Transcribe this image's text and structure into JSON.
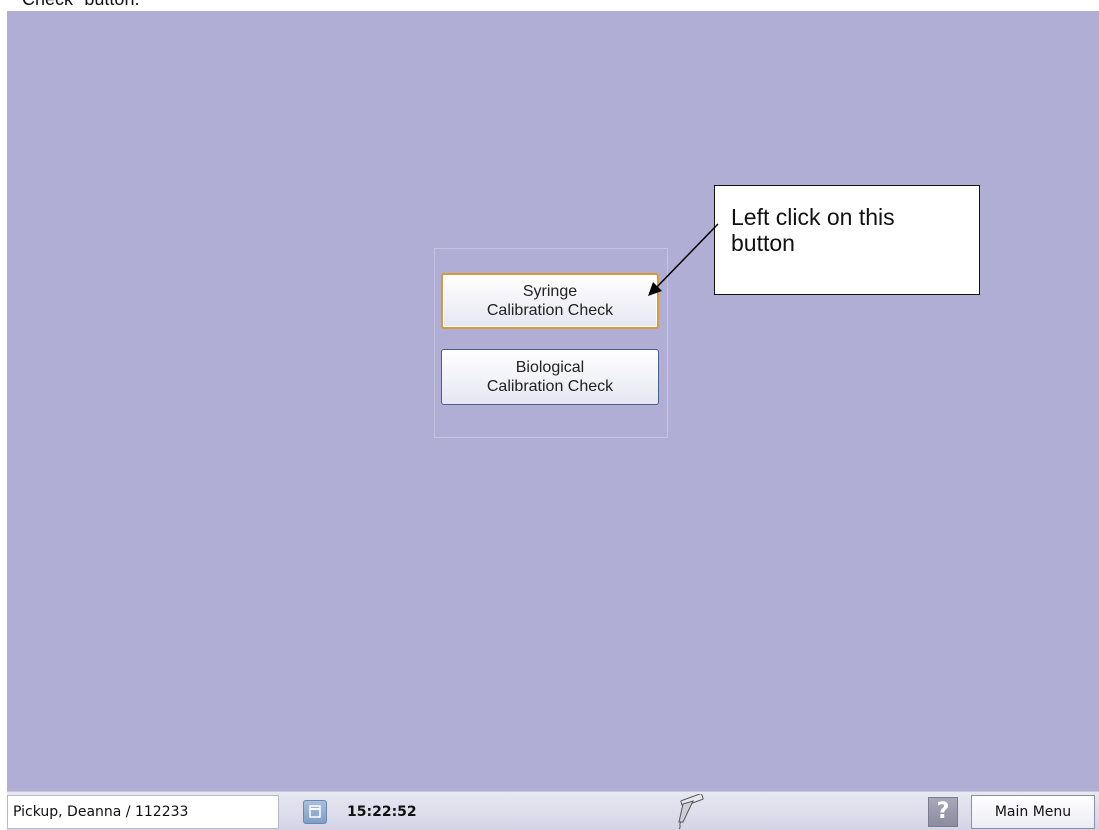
{
  "document": {
    "caption_fragment": "Check\" button."
  },
  "calibration_menu": {
    "syringe_button": {
      "line1": "Syringe",
      "line2": "Calibration Check"
    },
    "biological_button": {
      "line1": "Biological",
      "line2": "Calibration Check"
    }
  },
  "callout": {
    "text": "Left click on this button"
  },
  "status_bar": {
    "patient": "Pickup, Deanna / 112233",
    "time": "15:22:52",
    "help_label": "?",
    "main_menu_label": "Main Menu"
  },
  "colors": {
    "background": "#b0aed4",
    "focus_border": "#d79a3a",
    "status_bar": "#d4d4e6"
  },
  "icons": {
    "restore": "restore-window-icon",
    "instrument": "pipette-icon",
    "help": "help-icon"
  }
}
